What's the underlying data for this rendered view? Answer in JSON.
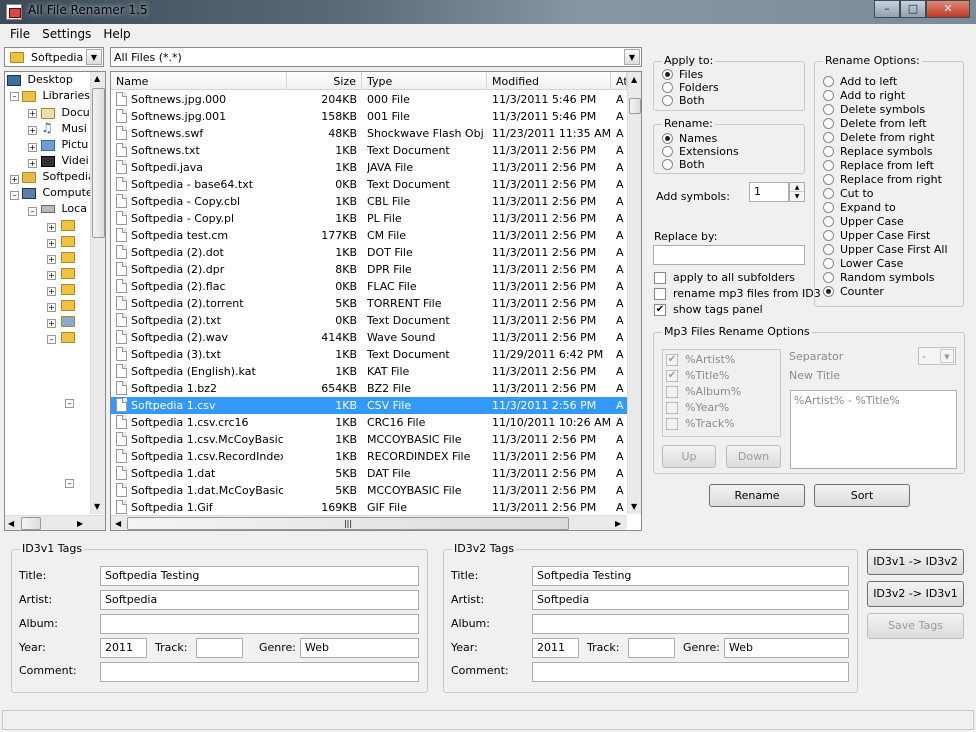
{
  "window": {
    "title": "All File Renamer 1.5"
  },
  "menu": [
    "File",
    "Settings",
    "Help"
  ],
  "drive_combo": {
    "value": "Softpedia"
  },
  "filter_combo": {
    "value": "All Files (*.*)"
  },
  "tree": [
    {
      "label": "Desktop",
      "icon": "desktop-icon"
    },
    {
      "label": "Libraries",
      "icon": "libraries-icon"
    },
    {
      "label": "Docu",
      "icon": "documents-icon"
    },
    {
      "label": "Musi",
      "icon": "music-icon"
    },
    {
      "label": "Pictu",
      "icon": "pictures-icon"
    },
    {
      "label": "Videi",
      "icon": "videos-icon"
    },
    {
      "label": "Softpedia",
      "icon": "user-folder-icon"
    },
    {
      "label": "Compute",
      "icon": "computer-icon"
    },
    {
      "label": "Loca",
      "icon": "drive-icon"
    }
  ],
  "file_columns": [
    "Name",
    "Size",
    "Type",
    "Modified",
    "At"
  ],
  "files": [
    {
      "name": "Softnews.jpg.000",
      "size": "204KB",
      "type": "000 File",
      "modified": "11/3/2011 5:46 PM",
      "attr": "A"
    },
    {
      "name": "Softnews.jpg.001",
      "size": "158KB",
      "type": "001 File",
      "modified": "11/3/2011 5:46 PM",
      "attr": "A"
    },
    {
      "name": "Softnews.swf",
      "size": "48KB",
      "type": "Shockwave Flash Obj...",
      "modified": "11/23/2011 11:35 AM",
      "attr": "A"
    },
    {
      "name": "Softnews.txt",
      "size": "1KB",
      "type": "Text Document",
      "modified": "11/3/2011 2:56 PM",
      "attr": "A"
    },
    {
      "name": "Softpedi.java",
      "size": "1KB",
      "type": "JAVA File",
      "modified": "11/3/2011 2:56 PM",
      "attr": "A"
    },
    {
      "name": "Softpedia - base64.txt",
      "size": "0KB",
      "type": "Text Document",
      "modified": "11/3/2011 2:56 PM",
      "attr": "A"
    },
    {
      "name": "Softpedia - Copy.cbl",
      "size": "1KB",
      "type": "CBL File",
      "modified": "11/3/2011 2:56 PM",
      "attr": "A"
    },
    {
      "name": "Softpedia - Copy.pl",
      "size": "1KB",
      "type": "PL File",
      "modified": "11/3/2011 2:56 PM",
      "attr": "A"
    },
    {
      "name": "Softpedia  test.cm",
      "size": "177KB",
      "type": "CM File",
      "modified": "11/3/2011 2:56 PM",
      "attr": "A"
    },
    {
      "name": "Softpedia (2).dot",
      "size": "1KB",
      "type": "DOT File",
      "modified": "11/3/2011 2:56 PM",
      "attr": "A"
    },
    {
      "name": "Softpedia (2).dpr",
      "size": "8KB",
      "type": "DPR File",
      "modified": "11/3/2011 2:56 PM",
      "attr": "A"
    },
    {
      "name": "Softpedia (2).flac",
      "size": "0KB",
      "type": "FLAC File",
      "modified": "11/3/2011 2:56 PM",
      "attr": "A"
    },
    {
      "name": "Softpedia (2).torrent",
      "size": "5KB",
      "type": "TORRENT File",
      "modified": "11/3/2011 2:56 PM",
      "attr": "A"
    },
    {
      "name": "Softpedia (2).txt",
      "size": "0KB",
      "type": "Text Document",
      "modified": "11/3/2011 2:56 PM",
      "attr": "A"
    },
    {
      "name": "Softpedia (2).wav",
      "size": "414KB",
      "type": "Wave Sound",
      "modified": "11/3/2011 2:56 PM",
      "attr": "A"
    },
    {
      "name": "Softpedia (3).txt",
      "size": "1KB",
      "type": "Text Document",
      "modified": "11/29/2011 6:42 PM",
      "attr": "A"
    },
    {
      "name": "Softpedia (English).kat",
      "size": "1KB",
      "type": "KAT File",
      "modified": "11/3/2011 2:56 PM",
      "attr": "A"
    },
    {
      "name": "Softpedia 1.bz2",
      "size": "654KB",
      "type": "BZ2 File",
      "modified": "11/3/2011 2:56 PM",
      "attr": "A"
    },
    {
      "name": "Softpedia 1.csv",
      "size": "1KB",
      "type": "CSV File",
      "modified": "11/3/2011 2:56 PM",
      "attr": "A",
      "selected": true
    },
    {
      "name": "Softpedia 1.csv.crc16",
      "size": "1KB",
      "type": "CRC16 File",
      "modified": "11/10/2011 10:26 AM",
      "attr": "A"
    },
    {
      "name": "Softpedia 1.csv.McCoyBasic",
      "size": "1KB",
      "type": "MCCOYBASIC File",
      "modified": "11/3/2011 2:56 PM",
      "attr": "A"
    },
    {
      "name": "Softpedia 1.csv.RecordIndex",
      "size": "1KB",
      "type": "RECORDINDEX File",
      "modified": "11/3/2011 2:56 PM",
      "attr": "A"
    },
    {
      "name": "Softpedia 1.dat",
      "size": "5KB",
      "type": "DAT File",
      "modified": "11/3/2011 2:56 PM",
      "attr": "A"
    },
    {
      "name": "Softpedia 1.dat.McCoyBasic",
      "size": "5KB",
      "type": "MCCOYBASIC File",
      "modified": "11/3/2011 2:56 PM",
      "attr": "A"
    },
    {
      "name": "Softpedia 1.Gif",
      "size": "169KB",
      "type": "GIF File",
      "modified": "11/3/2011 2:56 PM",
      "attr": "A"
    }
  ],
  "apply_to": {
    "label": "Apply to:",
    "options": [
      "Files",
      "Folders",
      "Both"
    ],
    "selected": "Files"
  },
  "rename_scope": {
    "label": "Rename:",
    "options": [
      "Names",
      "Extensions",
      "Both"
    ],
    "selected": "Names"
  },
  "add_symbols": {
    "label": "Add symbols:",
    "value": "1"
  },
  "replace_by": {
    "label": "Replace by:",
    "value": ""
  },
  "checks": [
    {
      "label": "apply to all subfolders",
      "checked": false
    },
    {
      "label": "rename mp3 files from ID3",
      "checked": false
    },
    {
      "label": "show tags panel",
      "checked": true
    }
  ],
  "rename_options": {
    "label": "Rename Options:",
    "options": [
      "Add to left",
      "Add to right",
      "Delete symbols",
      "Delete from left",
      "Delete from right",
      "Replace symbols",
      "Replace from left",
      "Replace from right",
      "Cut to",
      "Expand to",
      "Upper Case",
      "Upper Case First",
      "Upper Case First All",
      "Lower Case",
      "Random symbols",
      "Counter"
    ],
    "selected": "Counter"
  },
  "mp3_options": {
    "label": "Mp3 Files Rename Options",
    "tags": [
      {
        "label": "%Artist%",
        "checked": true
      },
      {
        "label": "%Title%",
        "checked": true
      },
      {
        "label": "%Album%",
        "checked": false
      },
      {
        "label": "%Year%",
        "checked": false
      },
      {
        "label": "%Track%",
        "checked": false
      }
    ],
    "separator_label": "Separator",
    "separator_value": "-",
    "new_title_label": "New Title",
    "new_title_value": "%Artist% - %Title%",
    "up": "Up",
    "down": "Down"
  },
  "buttons": {
    "rename": "Rename",
    "sort": "Sort",
    "id3v1_to_v2": "ID3v1 -> ID3v2",
    "id3v2_to_v1": "ID3v2 -> ID3v1",
    "save_tags": "Save Tags"
  },
  "id3v1": {
    "label": "ID3v1 Tags",
    "title_label": "Title:",
    "title": "Softpedia Testing",
    "artist_label": "Artist:",
    "artist": "Softpedia",
    "album_label": "Album:",
    "album": "",
    "year_label": "Year:",
    "year": "2011",
    "track_label": "Track:",
    "track": "",
    "genre_label": "Genre:",
    "genre": "Web",
    "comment_label": "Comment:",
    "comment": ""
  },
  "id3v2": {
    "label": "ID3v2 Tags",
    "title_label": "Title:",
    "title": "Softpedia Testing",
    "artist_label": "Artist:",
    "artist": "Softpedia",
    "album_label": "Album:",
    "album": "",
    "year_label": "Year:",
    "year": "2011",
    "track_label": "Track:",
    "track": "",
    "genre_label": "Genre:",
    "genre": "Web",
    "comment_label": "Comment:",
    "comment": ""
  }
}
